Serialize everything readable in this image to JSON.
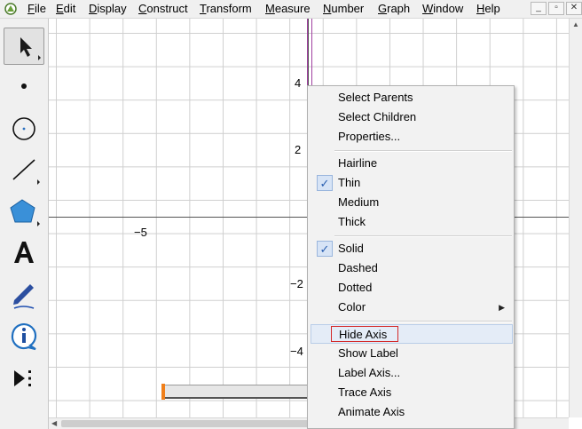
{
  "menubar": {
    "items": [
      {
        "id": "file",
        "label": "File",
        "accel": "F",
        "rest": "ile"
      },
      {
        "id": "edit",
        "label": "Edit",
        "accel": "E",
        "rest": "dit"
      },
      {
        "id": "display",
        "label": "Display",
        "accel": "D",
        "rest": "isplay"
      },
      {
        "id": "construct",
        "label": "Construct",
        "accel": "C",
        "rest": "onstruct"
      },
      {
        "id": "transform",
        "label": "Transform",
        "accel": "T",
        "rest": "ransform"
      },
      {
        "id": "measure",
        "label": "Measure",
        "accel": "M",
        "rest": "easure"
      },
      {
        "id": "number",
        "label": "Number",
        "accel": "N",
        "rest": "umber"
      },
      {
        "id": "graph",
        "label": "Graph",
        "accel": "G",
        "rest": "raph"
      },
      {
        "id": "window",
        "label": "Window",
        "accel": "W",
        "rest": "indow"
      },
      {
        "id": "help",
        "label": "Help",
        "accel": "H",
        "rest": "elp"
      }
    ],
    "window_buttons": [
      "_",
      "▫",
      "✕"
    ]
  },
  "toolbox": {
    "tools": [
      "arrow-select-tool",
      "point-tool",
      "compass-tool",
      "straightedge-tool",
      "polygon-tool",
      "text-tool",
      "marker-tool",
      "information-tool",
      "custom-tools"
    ]
  },
  "canvas": {
    "x_tick_labels": [
      "−5"
    ],
    "y_tick_labels": [
      "4",
      "2",
      "−2",
      "−4"
    ]
  },
  "context_menu": {
    "items": [
      {
        "label": "Select Parents"
      },
      {
        "label": "Select Children"
      },
      {
        "label": "Properties..."
      },
      {
        "label": "Hairline"
      },
      {
        "label": "Thin",
        "checked": true
      },
      {
        "label": "Medium"
      },
      {
        "label": "Thick"
      },
      {
        "label": "Solid",
        "checked": true
      },
      {
        "label": "Dashed"
      },
      {
        "label": "Dotted"
      },
      {
        "label": "Color",
        "submenu": true
      },
      {
        "label": "Hide Axis",
        "highlighted": true
      },
      {
        "label": "Show Label"
      },
      {
        "label": "Label Axis..."
      },
      {
        "label": "Trace Axis"
      },
      {
        "label": "Animate Axis"
      }
    ],
    "check_glyph": "✓",
    "submenu_glyph": "▶"
  },
  "colors": {
    "axis_highlight": "#a040a0",
    "slider_handle": "#f07f1a",
    "annotation_box": "#d42828"
  }
}
